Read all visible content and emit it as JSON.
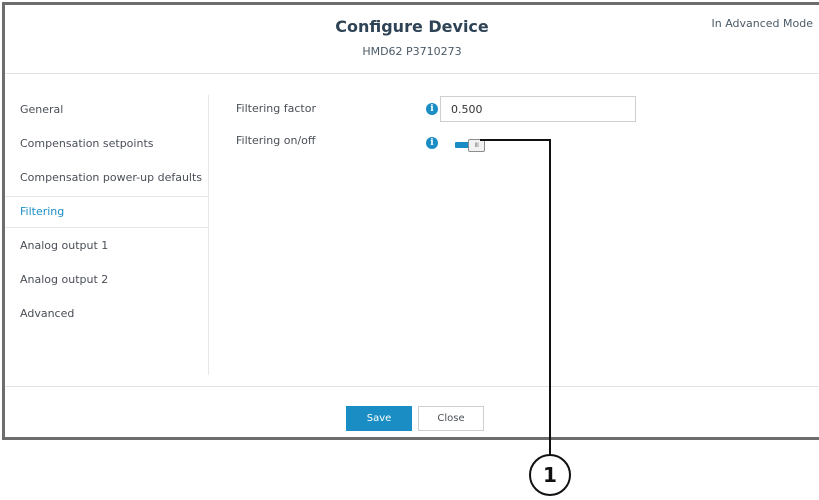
{
  "dialog": {
    "title": "Configure Device",
    "subtitle": "HMD62 P3710273",
    "mode": "In Advanced Mode"
  },
  "sidebar": {
    "items": [
      {
        "label": "General"
      },
      {
        "label": "Compensation setpoints"
      },
      {
        "label": "Compensation power-up defaults"
      },
      {
        "label": "Filtering",
        "active": true
      },
      {
        "label": "Analog output 1"
      },
      {
        "label": "Analog output 2"
      },
      {
        "label": "Advanced"
      }
    ]
  },
  "settings": {
    "filtering_factor_label": "Filtering factor",
    "filtering_factor_value": "0.500",
    "filtering_onoff_label": "Filtering on/off",
    "filtering_onoff_state": "on",
    "info_glyph": "i",
    "toggle_grip": "III"
  },
  "footer": {
    "save_label": "Save",
    "close_label": "Close"
  },
  "callout": {
    "number": "1"
  },
  "colors": {
    "accent": "#1a8ec4",
    "border": "#6d6d6d",
    "title": "#2e4355"
  }
}
